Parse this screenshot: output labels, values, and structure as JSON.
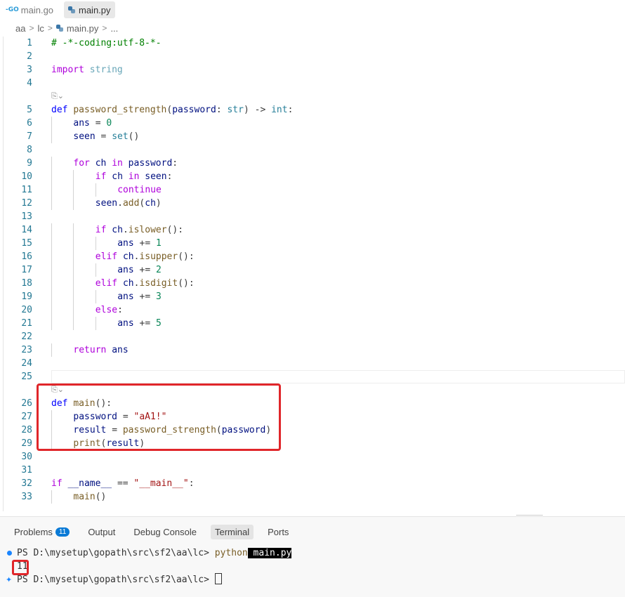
{
  "tabs": [
    {
      "label": "main.go",
      "icon": "go-icon",
      "prefix": "-GO"
    },
    {
      "label": "main.py",
      "icon": "python-icon"
    }
  ],
  "breadcrumb": [
    "aa",
    "lc",
    "main.py",
    "..."
  ],
  "editor": {
    "lines": [
      {
        "n": "1",
        "text": "# -*-coding:utf-8-*-"
      },
      {
        "n": "2",
        "text": ""
      },
      {
        "n": "3",
        "text": "import string"
      },
      {
        "n": "4",
        "text": ""
      },
      {
        "n": "5",
        "text": "def password_strength(password: str) -> int:"
      },
      {
        "n": "6",
        "text": "ans = 0"
      },
      {
        "n": "7",
        "text": "seen = set()"
      },
      {
        "n": "8",
        "text": ""
      },
      {
        "n": "9",
        "text": "for ch in password:"
      },
      {
        "n": "10",
        "text": "if ch in seen:"
      },
      {
        "n": "11",
        "text": "continue"
      },
      {
        "n": "12",
        "text": "seen.add(ch)"
      },
      {
        "n": "13",
        "text": ""
      },
      {
        "n": "14",
        "text": "if ch.islower():"
      },
      {
        "n": "15",
        "text": "ans += 1"
      },
      {
        "n": "16",
        "text": "elif ch.isupper():"
      },
      {
        "n": "17",
        "text": "ans += 2"
      },
      {
        "n": "18",
        "text": "elif ch.isdigit():"
      },
      {
        "n": "19",
        "text": "ans += 3"
      },
      {
        "n": "20",
        "text": "else:"
      },
      {
        "n": "21",
        "text": "ans += 5"
      },
      {
        "n": "22",
        "text": ""
      },
      {
        "n": "23",
        "text": "return ans"
      },
      {
        "n": "24",
        "text": ""
      },
      {
        "n": "25",
        "text": ""
      },
      {
        "n": "26",
        "text": "def main():"
      },
      {
        "n": "27",
        "text": "password = \"aA1!\""
      },
      {
        "n": "28",
        "text": "result = password_strength(password)"
      },
      {
        "n": "29",
        "text": "print(result)"
      },
      {
        "n": "30",
        "text": ""
      },
      {
        "n": "31",
        "text": ""
      },
      {
        "n": "32",
        "text": "if __name__ == \"__main__\":"
      },
      {
        "n": "33",
        "text": "main()"
      }
    ],
    "codelens_icon": "copilot-icon"
  },
  "panel": {
    "tabs": [
      {
        "label": "Problems",
        "badge": "11"
      },
      {
        "label": "Output"
      },
      {
        "label": "Debug Console"
      },
      {
        "label": "Terminal",
        "active": true
      },
      {
        "label": "Ports"
      }
    ],
    "terminal": {
      "prompt": "PS D:\\mysetup\\gopath\\src\\sf2\\aa\\lc>",
      "command": "python",
      "argument": " main.py",
      "output": "11"
    }
  },
  "colors": {
    "highlight": "#e0262a",
    "keyword": "#0000ff",
    "control": "#af00db",
    "function": "#795e26",
    "string": "#a31515",
    "number": "#098658",
    "line_number": "#237893"
  }
}
